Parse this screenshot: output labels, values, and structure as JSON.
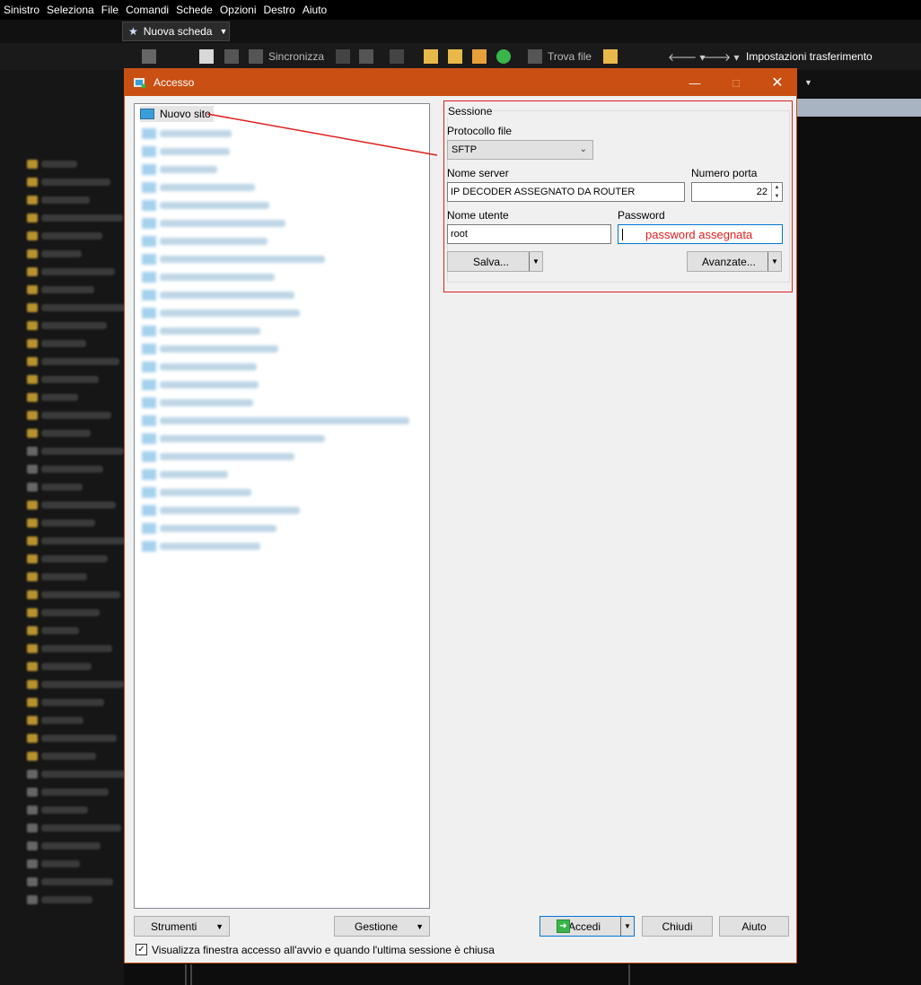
{
  "menubar": {
    "items": [
      "Sinistro",
      "Seleziona",
      "File",
      "Comandi",
      "Schede",
      "Opzioni",
      "Destro",
      "Aiuto"
    ]
  },
  "tab": {
    "label": "Nuova scheda"
  },
  "toolbar": {
    "sync_label": "Sincronizza",
    "find_label": "Trova file",
    "transfer_label": "Impostazioni trasferimento"
  },
  "dialog": {
    "title": "Accesso",
    "tree": {
      "first_item": "Nuovo sito"
    },
    "session": {
      "group_title": "Sessione",
      "protocol_label": "Protocollo file",
      "protocol_value": "SFTP",
      "server_label": "Nome server",
      "server_value": "IP DECODER ASSEGNATO DA ROUTER",
      "port_label": "Numero porta",
      "port_value": "22",
      "user_label": "Nome utente",
      "user_value": "root",
      "password_label": "Password",
      "password_annotation": "password assegnata",
      "save_label": "Salva...",
      "advanced_label": "Avanzate..."
    },
    "buttons": {
      "tools_label": "Strumenti",
      "manage_label": "Gestione",
      "login_label": "Accedi",
      "close_label": "Chiudi",
      "help_label": "Aiuto"
    },
    "checkbox_label": "Visualizza finestra accesso all'avvio e quando l'ultima sessione è chiusa",
    "colors": {
      "title_bar": "#c94f12",
      "annotation": "#e01e1e",
      "focus": "#0078d7"
    }
  }
}
